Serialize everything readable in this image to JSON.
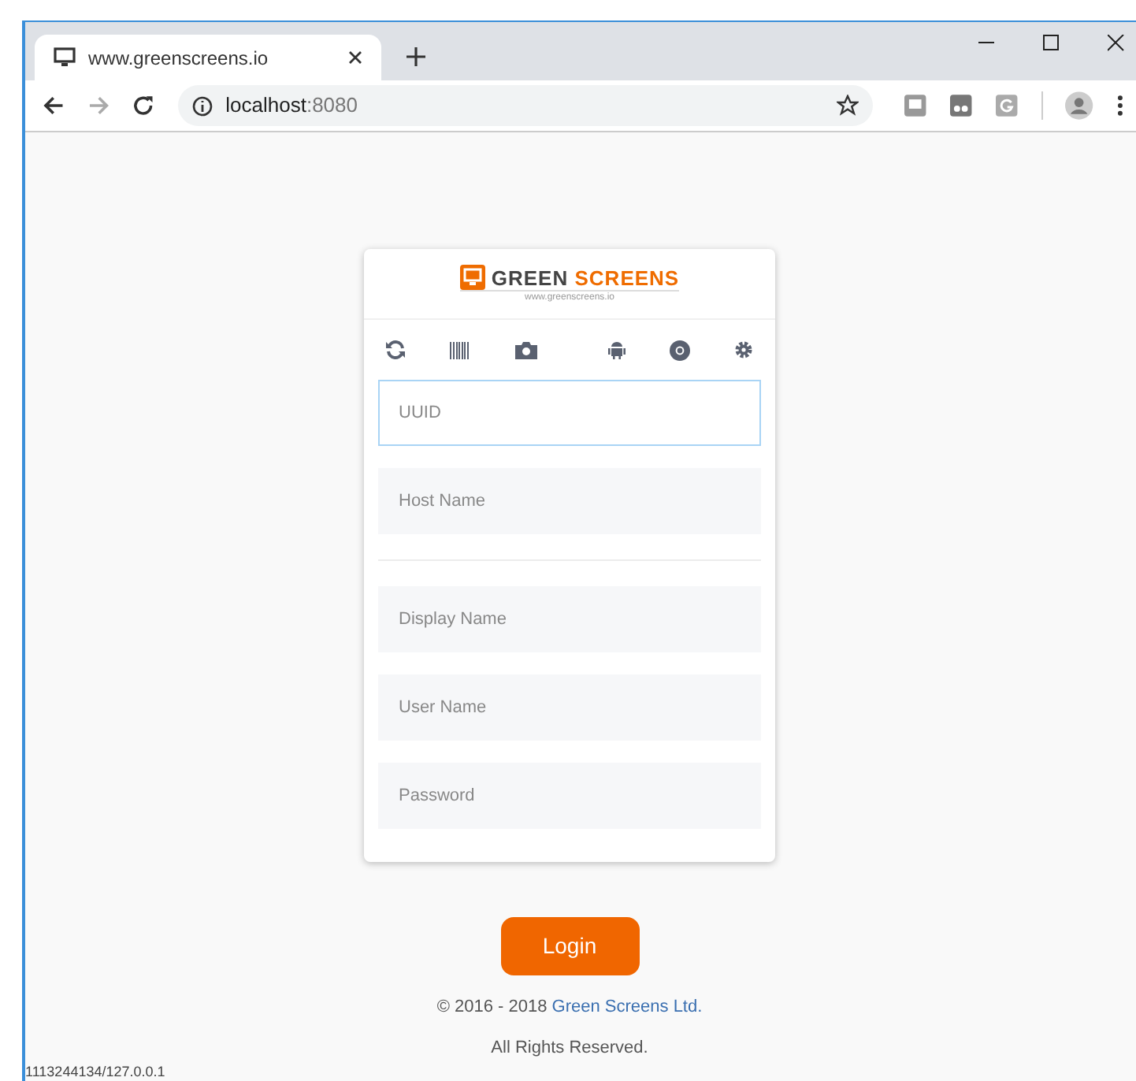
{
  "browser": {
    "tab_title": "www.greenscreens.io",
    "address_host": "localhost",
    "address_port": ":8080"
  },
  "logo": {
    "word_1": "GREEN",
    "word_2": "SCREENS",
    "tagline": "www.greenscreens.io"
  },
  "fields": [
    {
      "placeholder": "UUID",
      "focused": true,
      "divider_after": false
    },
    {
      "placeholder": "Host Name",
      "focused": false,
      "divider_after": true
    },
    {
      "placeholder": "Display Name",
      "focused": false,
      "divider_after": false
    },
    {
      "placeholder": "User Name",
      "focused": false,
      "divider_after": false
    },
    {
      "placeholder": "Password",
      "focused": false,
      "divider_after": false
    }
  ],
  "login_button": "Login",
  "footer": {
    "copyright": "© 2016 - 2018",
    "company_link": "Green Screens Ltd.",
    "rights": "All Rights Reserved."
  },
  "status_text": "1113244134/127.0.0.1"
}
